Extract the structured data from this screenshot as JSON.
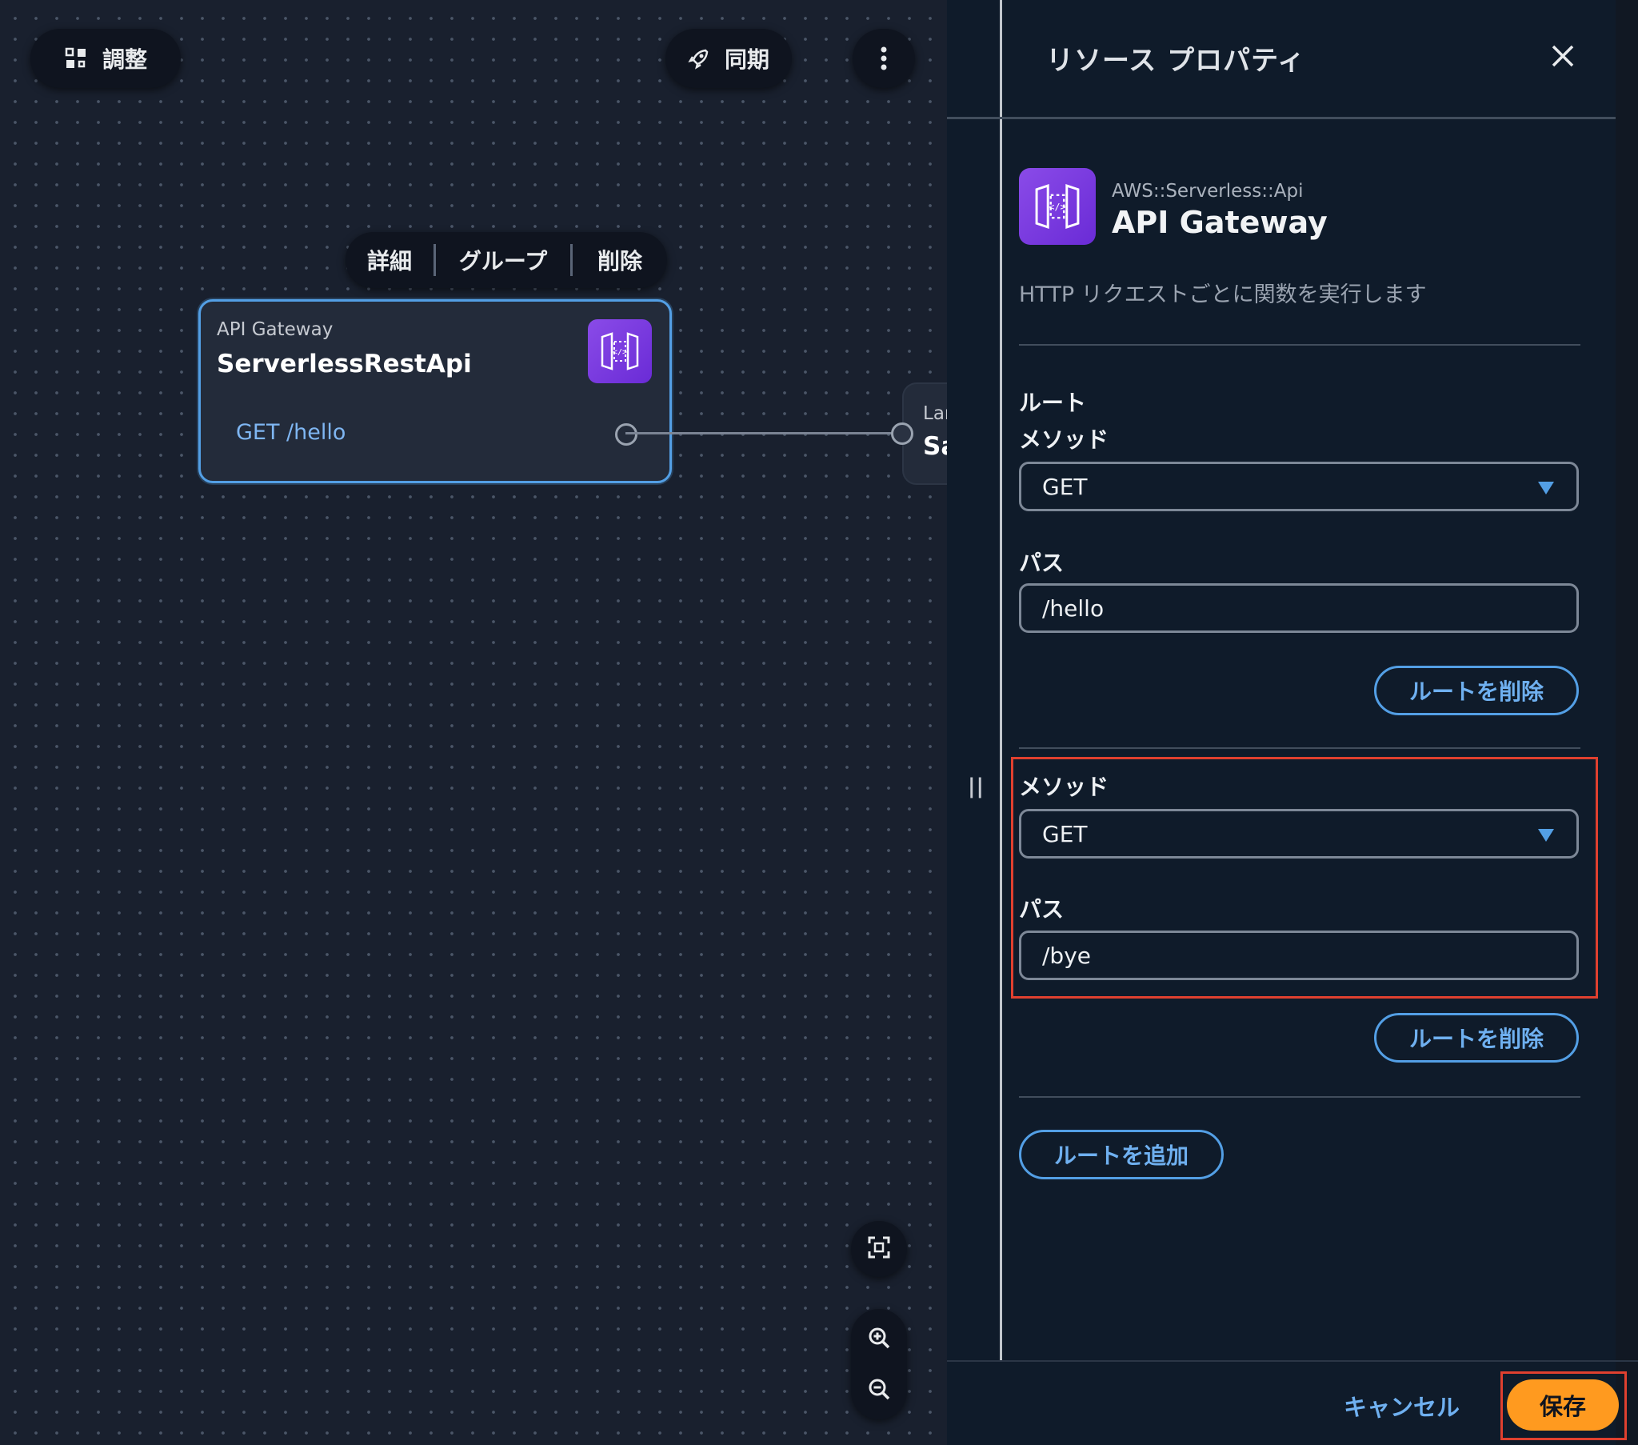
{
  "toolbar": {
    "arrange_label": "調整",
    "sync_label": "同期"
  },
  "context_menu": {
    "details": "詳細",
    "group": "グループ",
    "delete": "削除"
  },
  "node": {
    "type": "API Gateway",
    "name": "ServerlessRestApi",
    "route": "GET /hello"
  },
  "lambda_node": {
    "type": "Lar",
    "name": "Sa"
  },
  "panel": {
    "title": "リソース プロパティ",
    "resource_type": "AWS::Serverless::Api",
    "resource_name": "API Gateway",
    "description": "HTTP リクエストごとに関数を実行します",
    "routes_label": "ルート",
    "routes": [
      {
        "method_label": "メソッド",
        "method": "GET",
        "path_label": "パス",
        "path": "/hello",
        "delete_label": "ルートを削除"
      },
      {
        "method_label": "メソッド",
        "method": "GET",
        "path_label": "パス",
        "path": "/bye",
        "delete_label": "ルートを削除"
      }
    ],
    "add_route_label": "ルートを追加",
    "cancel_label": "キャンセル",
    "save_label": "保存"
  },
  "colors": {
    "accent": "#539fe5",
    "primary_button": "#ff9a1f",
    "highlight": "#e0402f",
    "resource_icon": "#7b3fe4"
  },
  "icons": [
    "arrange-icon",
    "rocket-icon",
    "more-vertical-icon",
    "api-gateway-icon",
    "close-icon",
    "fit-view-icon",
    "zoom-in-icon",
    "zoom-out-icon",
    "dropdown-arrow-icon",
    "resize-handle-icon"
  ]
}
